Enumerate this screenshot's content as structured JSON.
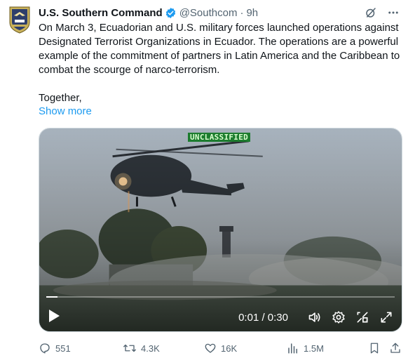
{
  "tweet": {
    "author_name": "U.S. Southern Command",
    "handle": "@Southcom",
    "separator": "·",
    "time": "9h",
    "text": "On March 3, Ecuadorian and U.S. military forces launched operations against Designated Terrorist Organizations in Ecuador. The operations are a powerful example of the commitment of partners in Latin America and the Caribbean to combat the scourge of narco-terrorism.\n\nTogether,",
    "show_more": "Show more"
  },
  "video": {
    "overlay_label": "UNCLASSIFIED",
    "time_readout": "0:01 / 0:30",
    "progress": 0.033
  },
  "actions": {
    "replies": "551",
    "reposts": "4.3K",
    "likes": "16K",
    "views": "1.5M"
  },
  "icons": [
    "southcom-seal-icon",
    "verified-badge-icon",
    "grok-icon",
    "more-icon",
    "play-icon",
    "volume-icon",
    "settings-icon",
    "pip-icon",
    "fullscreen-icon",
    "reply-icon",
    "repost-icon",
    "like-icon",
    "views-icon",
    "bookmark-icon",
    "share-icon"
  ],
  "colors": {
    "link": "#1d9bf0",
    "secondary_text": "#536471",
    "verified": "#1d9bf0"
  }
}
